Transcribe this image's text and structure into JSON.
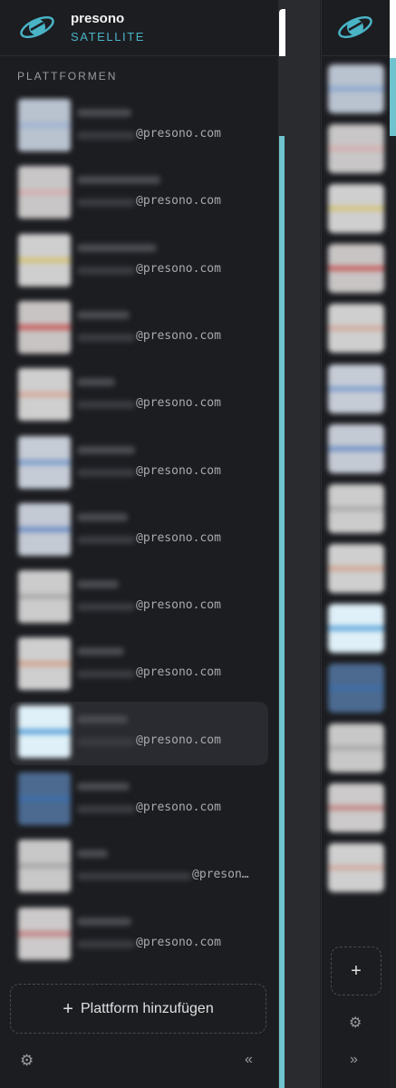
{
  "brand": {
    "name": "presono",
    "sub": "SATELLITE"
  },
  "section_title": "PLATTFORMEN",
  "platforms": [
    {
      "domain": "@presono.com",
      "thumb": "#b9c2cf",
      "accent": "#9ab0d0",
      "active": false
    },
    {
      "domain": "@presono.com",
      "thumb": "#c8c6c6",
      "accent": "#d8a8a8",
      "active": false
    },
    {
      "domain": "@presono.com",
      "thumb": "#cfcfcf",
      "accent": "#d6c060",
      "active": false
    },
    {
      "domain": "@presono.com",
      "thumb": "#c8c4c4",
      "accent": "#c84040",
      "active": false
    },
    {
      "domain": "@presono.com",
      "thumb": "#cfcfcf",
      "accent": "#d4a090",
      "active": false
    },
    {
      "domain": "@presono.com",
      "thumb": "#c6ccd6",
      "accent": "#6a90c8",
      "active": false
    },
    {
      "domain": "@presono.com",
      "thumb": "#c4cad4",
      "accent": "#5880c0",
      "active": false
    },
    {
      "domain": "@presono.com",
      "thumb": "#cccccc",
      "accent": "#a0a0a0",
      "active": false
    },
    {
      "domain": "@presono.com",
      "thumb": "#cfcfcf",
      "accent": "#d09a80",
      "active": false
    },
    {
      "domain": "@presono.com",
      "thumb": "#dff0f8",
      "accent": "#3c90d0",
      "active": true
    },
    {
      "domain": "@presono.com",
      "thumb": "#4c6a90",
      "accent": "#3a70b0",
      "active": false
    },
    {
      "domain": "@preson…",
      "thumb": "#c8c8c8",
      "accent": "#a0a0a0",
      "active": false
    },
    {
      "domain": "@presono.com",
      "thumb": "#cccaca",
      "accent": "#c07070",
      "active": false
    }
  ],
  "rail_thumbs": [
    {
      "thumb": "#b9c2cf",
      "accent": "#7ea0d0"
    },
    {
      "thumb": "#c8c6c6",
      "accent": "#d8a8a8"
    },
    {
      "thumb": "#cfcfcf",
      "accent": "#d6c060"
    },
    {
      "thumb": "#c8c4c4",
      "accent": "#c84040"
    },
    {
      "thumb": "#cfcfcf",
      "accent": "#d4a090"
    },
    {
      "thumb": "#c6ccd6",
      "accent": "#6a90c8"
    },
    {
      "thumb": "#c4cad4",
      "accent": "#5880c0"
    },
    {
      "thumb": "#cccccc",
      "accent": "#a0a0a0"
    },
    {
      "thumb": "#cfcfcf",
      "accent": "#d09a80"
    },
    {
      "thumb": "#dff0f8",
      "accent": "#3c90d0"
    },
    {
      "thumb": "#4c6a90",
      "accent": "#3a70b0"
    },
    {
      "thumb": "#c8c8c8",
      "accent": "#a0a0a0"
    },
    {
      "thumb": "#cccaca",
      "accent": "#c07070"
    },
    {
      "thumb": "#cfcfcf",
      "accent": "#d0a090"
    }
  ],
  "add_button": {
    "plus": "+",
    "label": "Plattform hinzufügen"
  },
  "rail_add": {
    "plus": "+"
  },
  "icons": {
    "settings": "⚙",
    "collapse": "«",
    "expand": "»",
    "logo": "planet-logo-icon"
  },
  "colors": {
    "accent": "#49b4c6",
    "background": "#1c1d21",
    "active_row": "#2a2b30"
  }
}
